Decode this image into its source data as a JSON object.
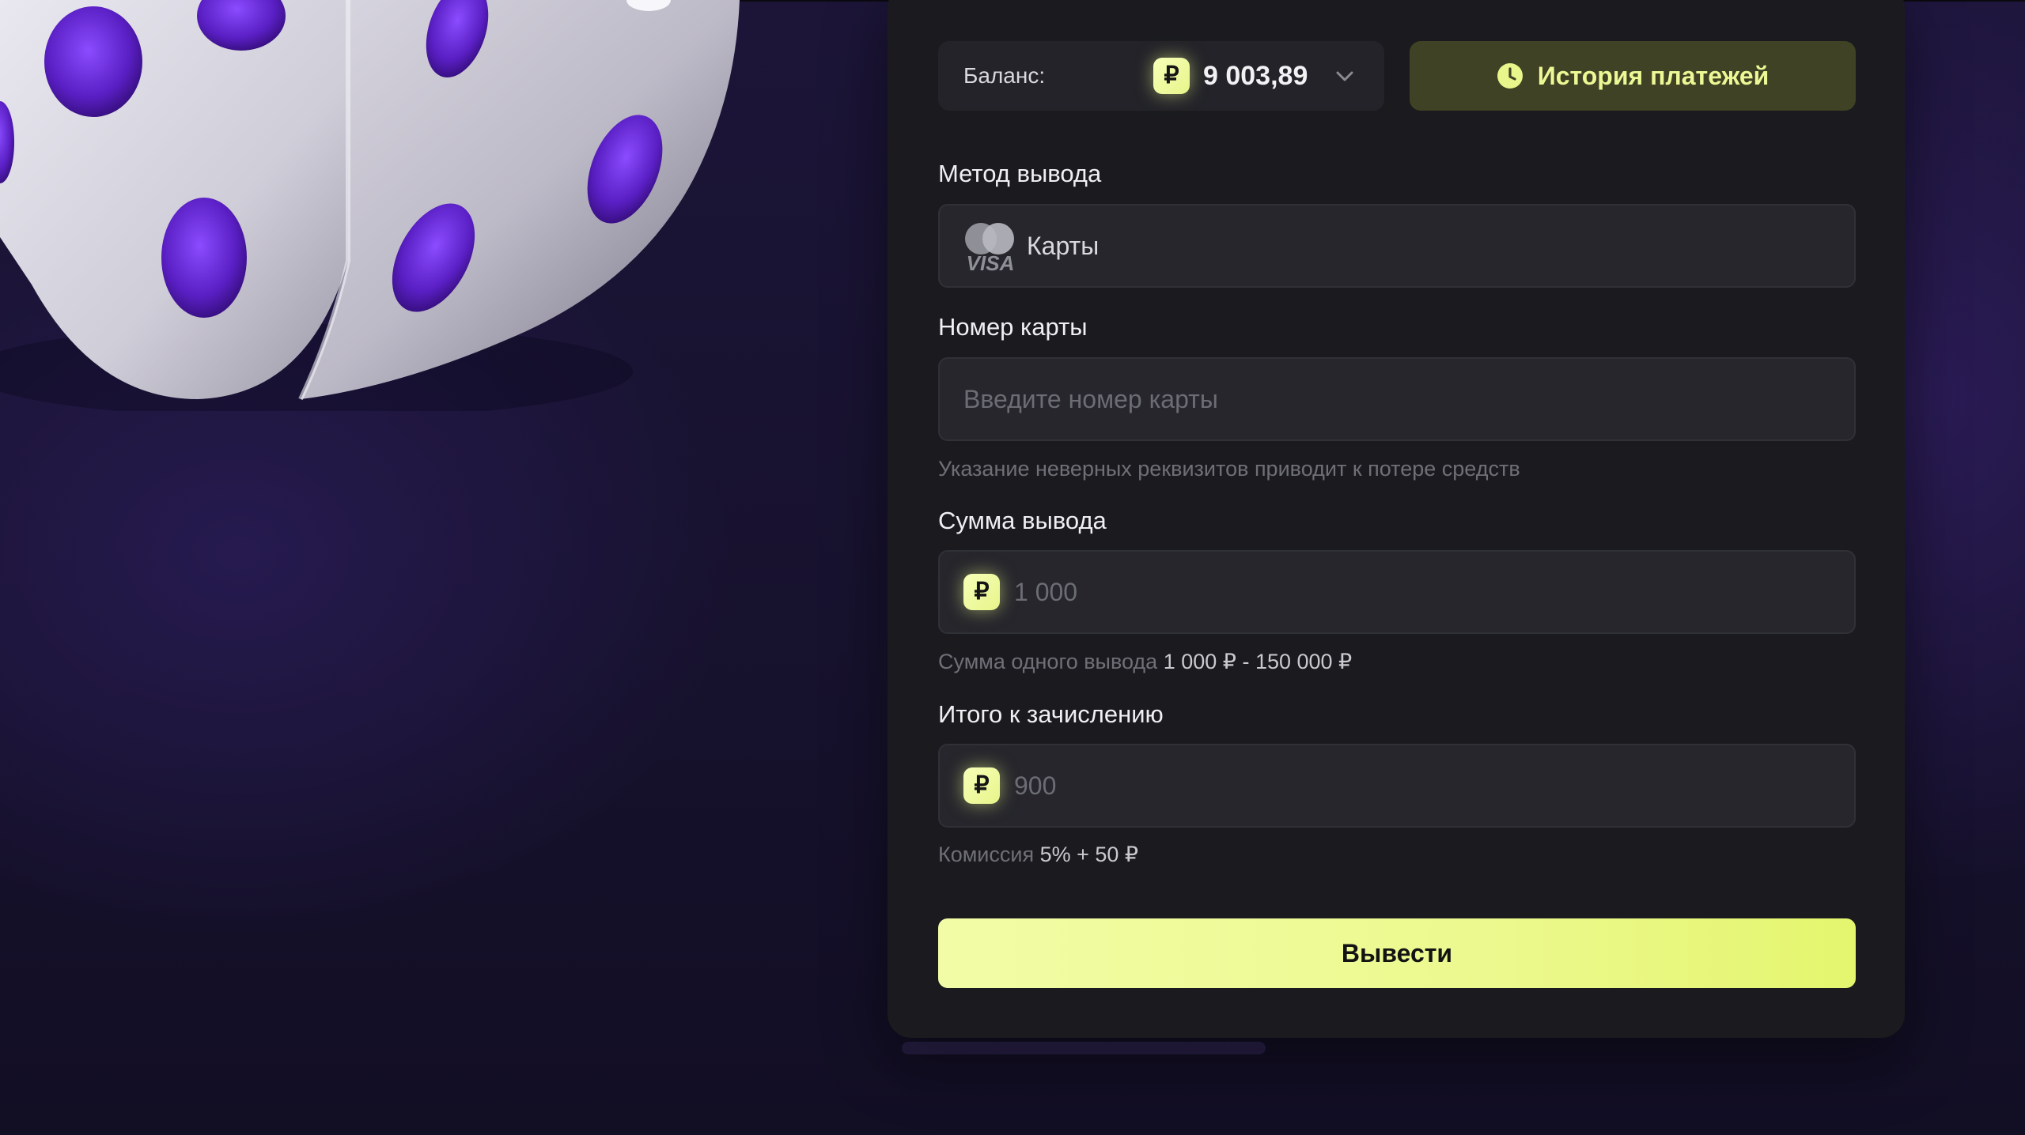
{
  "balance": {
    "label": "Баланс:",
    "currency_icon": "ruble-icon",
    "amount": "9 003,89",
    "dropdown_icon": "chevron-down-icon"
  },
  "history_button": {
    "icon": "clock-icon",
    "label": "История платежей"
  },
  "withdraw_method": {
    "label": "Метод вывода",
    "icon": "card-brands-icon",
    "value": "Карты",
    "logo_text": "VISA"
  },
  "card_number": {
    "label": "Номер карты",
    "placeholder": "Введите номер карты",
    "hint": "Указание неверных реквизитов приводит к потере средств"
  },
  "amount": {
    "label": "Сумма вывода",
    "currency_icon": "ruble-icon",
    "placeholder": "1 000",
    "hint_prefix": "Сумма одного вывода",
    "hint_range": "1 000 ₽ - 150 000 ₽"
  },
  "total": {
    "label": "Итого к зачислению",
    "currency_icon": "ruble-icon",
    "value": "900",
    "hint_prefix": "Комиссия",
    "hint_fee": "5% + 50 ₽"
  },
  "submit_button": {
    "label": "Вывести"
  },
  "currency_symbol": "₽",
  "colors": {
    "accent": "#ecf98e",
    "panel": "#1b1b1f",
    "field": "#26262c",
    "history_bg": "#3f4224",
    "dice_pip": "#6a2bd6"
  }
}
